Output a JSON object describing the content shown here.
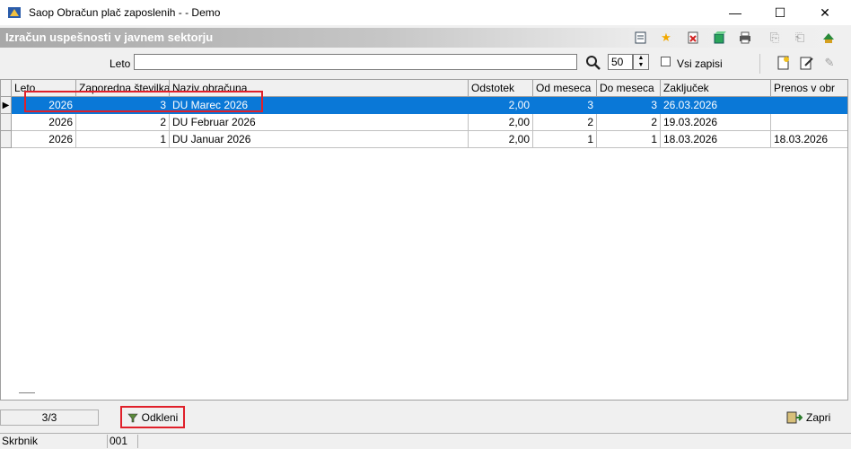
{
  "window": {
    "title": "Saop Obračun plač zaposlenih -  - Demo",
    "minimize": "—",
    "maximize": "☐",
    "close": "✕"
  },
  "header": {
    "title": "Izračun uspešnosti v javnem sektorju",
    "icons": [
      "report-icon",
      "star-icon",
      "delete-icon",
      "box-icon",
      "print-icon",
      "copy-icon",
      "paste-icon",
      "exit-icon"
    ]
  },
  "filter": {
    "leto_label": "Leto",
    "leto_value": "",
    "count": "50",
    "vsi_zapisi_label": "Vsi zapisi",
    "vsi_zapisi_checked": false
  },
  "table": {
    "columns": [
      "Leto",
      "Zaporedna številka",
      "Naziv obračuna",
      "Odstotek",
      "Od meseca",
      "Do meseca",
      "Zaključek",
      "Prenos v obr"
    ],
    "rows": [
      [
        "2026",
        "3",
        "DU Marec 2026",
        "2,00",
        "3",
        "3",
        "26.03.2026",
        ""
      ],
      [
        "2026",
        "2",
        "DU Februar 2026",
        "2,00",
        "2",
        "2",
        "19.03.2026",
        ""
      ],
      [
        "2026",
        "1",
        "DU Januar 2026",
        "2,00",
        "1",
        "1",
        "18.03.2026",
        "18.03.2026"
      ]
    ],
    "selected_row": 0
  },
  "footer": {
    "record_count": "3/3",
    "odkleni_label": "Odkleni",
    "zapri_label": "Zapri"
  },
  "status": {
    "label": "Skrbnik",
    "code": "001"
  },
  "colors": {
    "selection": "#0a78d7",
    "highlight": "#e0202a"
  }
}
